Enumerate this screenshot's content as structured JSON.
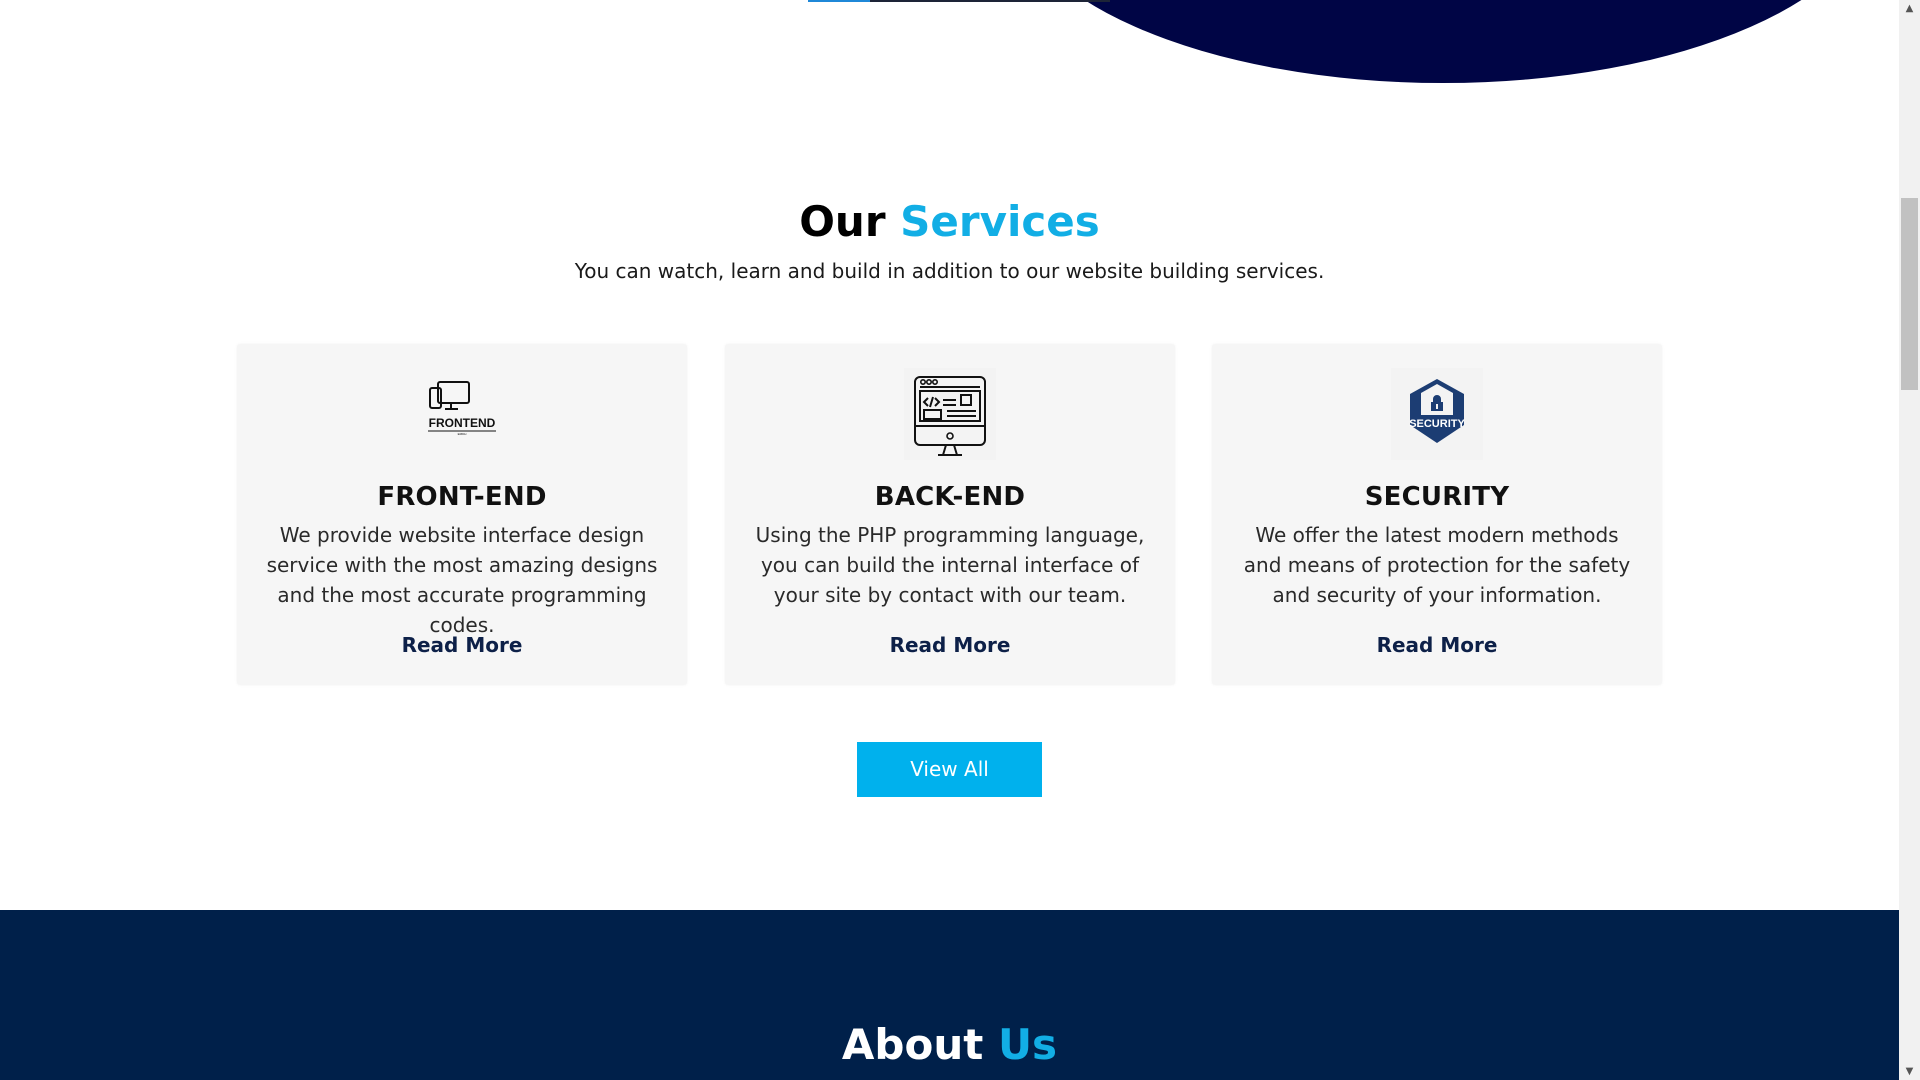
{
  "services": {
    "title": {
      "prefix": "Our",
      "accent": "Services"
    },
    "subtitle": "You can watch, learn and build in addition to our website building services.",
    "cards": [
      {
        "title": "FRONT-END",
        "description": "We provide website interface design service with the most amazing designs and the most accurate programming codes.",
        "link_label": "Read More",
        "icon": "frontend-devices-icon",
        "icon_caption": "FRONTEND",
        "icon_subcaption": "EMDH"
      },
      {
        "title": "BACK-END",
        "description": "Using the PHP programming language, you can build the internal interface of your site by contact with our team.",
        "link_label": "Read More",
        "icon": "backend-monitor-code-icon"
      },
      {
        "title": "SECURITY",
        "description": "We offer the latest modern methods and means of protection for the safety and security of your information.",
        "link_label": "Read More",
        "icon": "security-shield-lock-icon",
        "icon_caption": "SECURITY"
      }
    ],
    "view_all_label": "View All"
  },
  "about": {
    "title": {
      "prefix": "About",
      "accent": "Us"
    }
  },
  "colors": {
    "accent": "#12aee5",
    "hero_navy": "#000545",
    "about_navy": "#00204a",
    "button_blue": "#00b1ed",
    "card_background": "#f6f6f6",
    "security_blue": "#1c3d73"
  },
  "scrollbar": {
    "up_icon": "scroll-up-arrow-icon",
    "down_icon": "scroll-down-arrow-icon"
  }
}
